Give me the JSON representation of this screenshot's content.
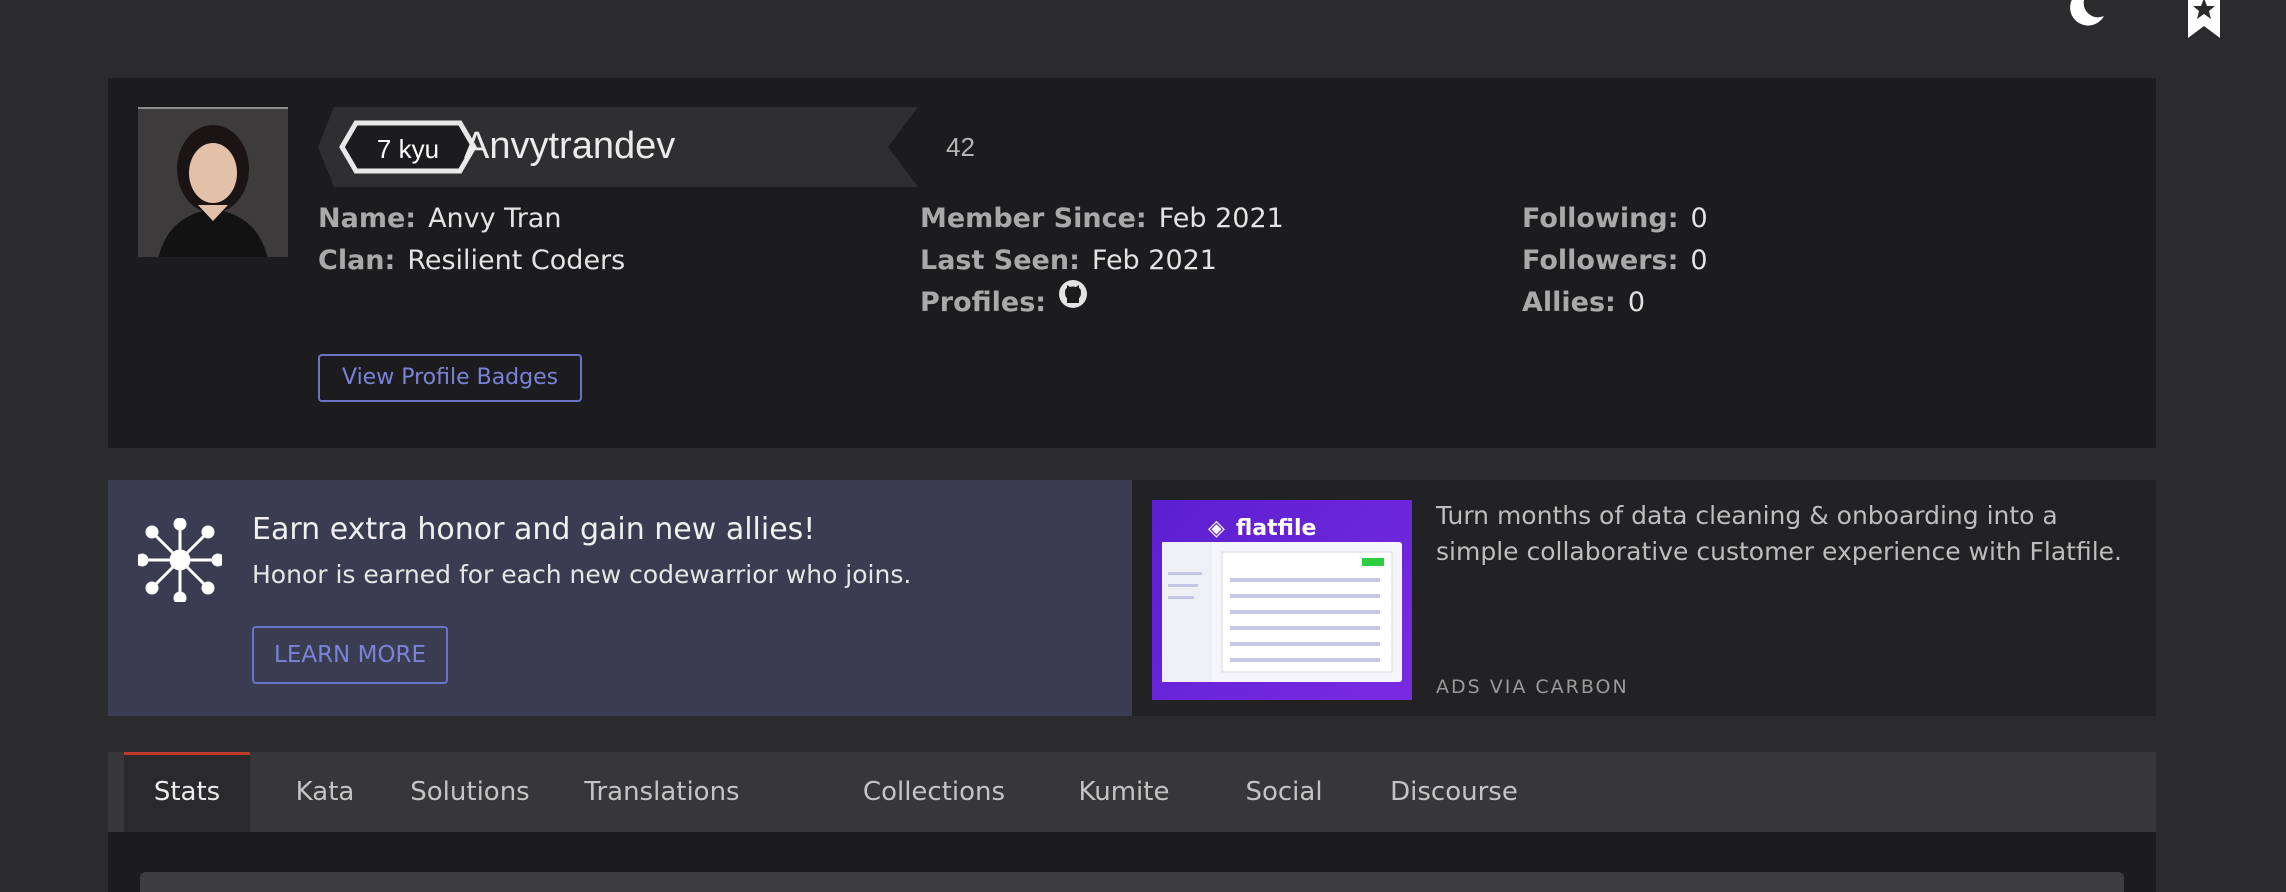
{
  "header": {
    "moon_icon": "moon-icon",
    "bookmark_icon": "bookmark-star-icon"
  },
  "profile": {
    "rank": "7 kyu",
    "username": "Anvytrandev",
    "honor": "42",
    "name_label": "Name:",
    "name_value": "Anvy Tran",
    "clan_label": "Clan:",
    "clan_value": "Resilient Coders",
    "member_since_label": "Member Since:",
    "member_since_value": "Feb 2021",
    "last_seen_label": "Last Seen:",
    "last_seen_value": "Feb 2021",
    "profiles_label": "Profiles:",
    "profiles_icon": "github-icon",
    "following_label": "Following:",
    "following_value": "0",
    "followers_label": "Followers:",
    "followers_value": "0",
    "allies_label": "Allies:",
    "allies_value": "0",
    "badges_button": "View Profile Badges"
  },
  "promo": {
    "title": "Earn extra honor and gain new allies!",
    "subtitle": "Honor is earned for each new codewarrior who joins.",
    "button": "LEARN MORE",
    "icon": "network-icon"
  },
  "ad": {
    "brand": "flatfile",
    "text": "Turn months of data cleaning & onboarding into a simple collaborative customer experience with Flatfile.",
    "via": "ADS VIA CARBON"
  },
  "tabs": [
    {
      "label": "Stats",
      "active": true
    },
    {
      "label": "Kata"
    },
    {
      "label": "Solutions"
    },
    {
      "label": "Translations"
    },
    {
      "label": "Collections"
    },
    {
      "label": "Kumite"
    },
    {
      "label": "Social"
    },
    {
      "label": "Discourse"
    }
  ],
  "colors": {
    "accent": "#6b72c8",
    "active_tab": "#c0392b",
    "promo_bg": "#3a3d52",
    "ad_purple": "#6a24d8"
  }
}
